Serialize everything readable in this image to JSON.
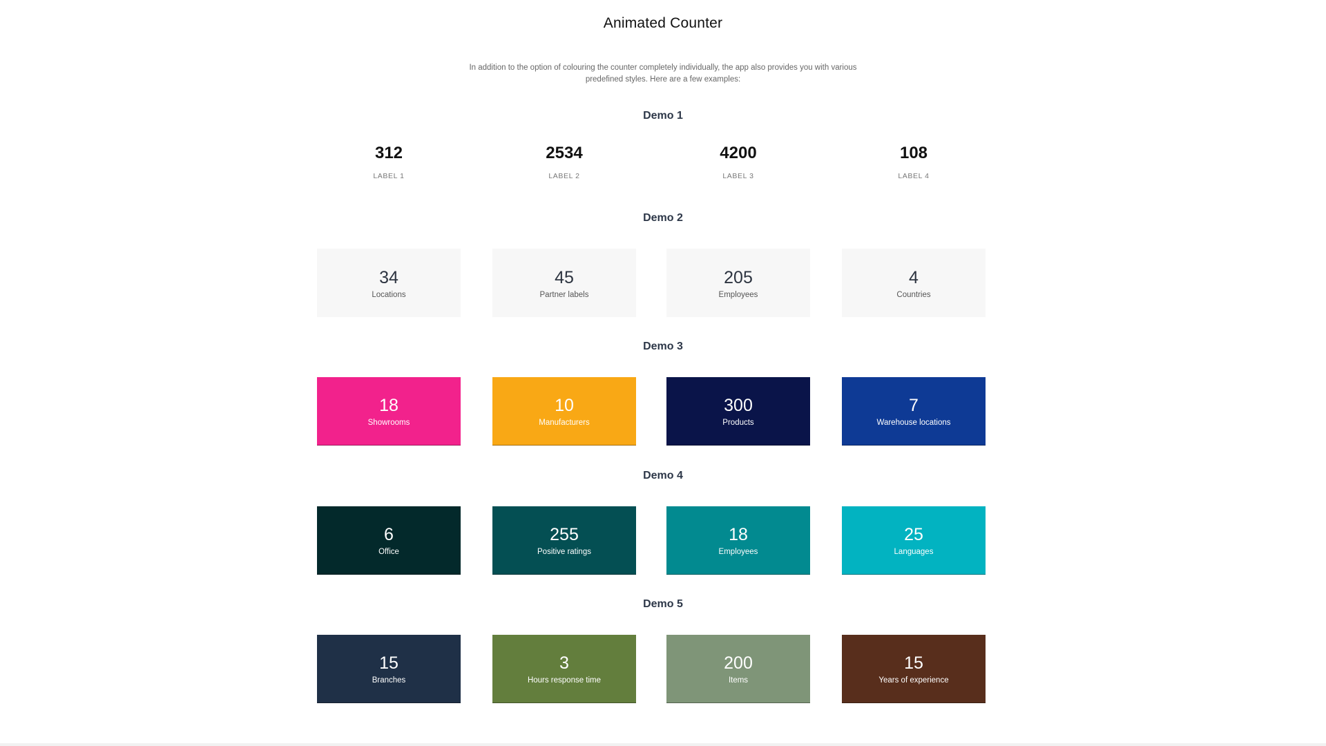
{
  "page": {
    "title": "Animated Counter",
    "intro": "In addition to the option of colouring the counter completely individually, the app also provides you with various predefined styles. Here are a few examples:"
  },
  "demos": [
    {
      "title": "Demo 1",
      "items": [
        {
          "value": "312",
          "label": "LABEL 1"
        },
        {
          "value": "2534",
          "label": "LABEL 2"
        },
        {
          "value": "4200",
          "label": "LABEL 3"
        },
        {
          "value": "108",
          "label": "LABEL 4"
        }
      ]
    },
    {
      "title": "Demo 2",
      "items": [
        {
          "value": "34",
          "label": "Locations",
          "color": "#f7f7f7"
        },
        {
          "value": "45",
          "label": "Partner labels",
          "color": "#f7f7f7"
        },
        {
          "value": "205",
          "label": "Employees",
          "color": "#f7f7f7"
        },
        {
          "value": "4",
          "label": "Countries",
          "color": "#f7f7f7"
        }
      ]
    },
    {
      "title": "Demo 3",
      "items": [
        {
          "value": "18",
          "label": "Showrooms",
          "color": "#f2228c"
        },
        {
          "value": "10",
          "label": "Manufacturers",
          "color": "#f9a815"
        },
        {
          "value": "300",
          "label": "Products",
          "color": "#0a1449"
        },
        {
          "value": "7",
          "label": "Warehouse locations",
          "color": "#0e3a95"
        }
      ]
    },
    {
      "title": "Demo 4",
      "items": [
        {
          "value": "6",
          "label": "Office",
          "color": "#03292b"
        },
        {
          "value": "255",
          "label": "Positive ratings",
          "color": "#044f53"
        },
        {
          "value": "18",
          "label": "Employees",
          "color": "#028a90"
        },
        {
          "value": "25",
          "label": "Languages",
          "color": "#02b3c1"
        }
      ]
    },
    {
      "title": "Demo 5",
      "items": [
        {
          "value": "15",
          "label": "Branches",
          "color": "#1f3047"
        },
        {
          "value": "3",
          "label": "Hours response time",
          "color": "#637e3d"
        },
        {
          "value": "200",
          "label": "Items",
          "color": "#7f9578"
        },
        {
          "value": "15",
          "label": "Years of experience",
          "color": "#582e1c"
        }
      ]
    }
  ]
}
